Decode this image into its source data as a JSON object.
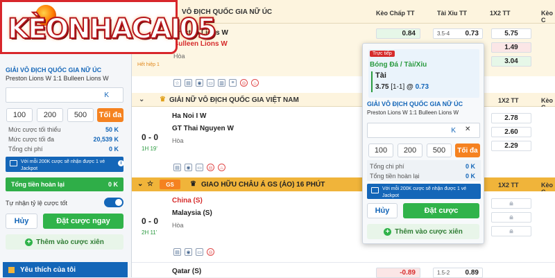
{
  "logo": {
    "text": "KÈONHACAI05"
  },
  "betslip": {
    "league": "GIẢI VÔ ĐỊCH QUỐC GIA NỮ ÚC",
    "match": "Preston Lions W 1:1 Bulleen Lions W",
    "input_suffix": "K",
    "amounts": [
      "100",
      "200",
      "500"
    ],
    "max_label": "Tối đa",
    "stats": [
      {
        "label": "Mức cược tối thiểu",
        "value": "50 K"
      },
      {
        "label": "Mức cược tối đa",
        "value": "20,539 K"
      },
      {
        "label": "Tổng chi phí",
        "value": "0 K"
      }
    ],
    "promo": "Với mỗi 200K cược sẽ nhận được 1 vé Jackpot",
    "refund_label": "Tổng tiền hoàn lại",
    "refund_value": "0 K",
    "auto_accept_label": "Tự nhận tỷ lệ cược tốt",
    "cancel_label": "Hủy",
    "place_label": "Đặt cược ngay",
    "add_parlay_label": "Thêm vào cược xiên",
    "favorites_label": "Yêu thích của tôi"
  },
  "columns": {
    "handicap": "Kèo Chấp TT",
    "overunder": "Tài Xỉu TT",
    "x12": "1X2 TT",
    "extra": "Kèo C"
  },
  "leagues": [
    {
      "name": "VÔ ĐỊCH QUỐC GIA NỮ ÚC",
      "home": "Preston Lions W",
      "away": "Bulleen Lions W",
      "draw": "Hòa",
      "status": "Hết hiệp 1",
      "odds": {
        "hcp_home": "0.84",
        "ou_line": "3.5-4",
        "ou_over": "0.73",
        "x1": "5.75",
        "x2": "1.49",
        "xd": "3.04"
      }
    },
    {
      "name": "GIẢI NỮ VÔ ĐỊCH QUỐC GIA VIỆT NAM",
      "home": "Ha Noi I W",
      "away": "GT Thai Nguyen W",
      "draw": "Hòa",
      "score": "0 - 0",
      "time": "1H 19'",
      "odds": {
        "x1": "2.78",
        "x2": "2.60",
        "xd": "2.29"
      }
    },
    {
      "name": "GIAO HỮU CHÂU Á GS (ẢO) 16 PHÚT",
      "badge": "GS",
      "home": "China (S)",
      "away": "Malaysia (S)",
      "draw": "Hòa",
      "score": "0 - 0",
      "time": "2H 11'"
    },
    {
      "home": "Qatar (S)",
      "odds": {
        "hcp_home": "-0.89",
        "ou_line": "1.5-2",
        "ou_over": "0.89"
      }
    }
  ],
  "popup": {
    "live_tag": "Trực tiếp",
    "market": "Bóng Đá / Tài/Xỉu",
    "selection": "Tài",
    "line": "3.75",
    "score": "[1-1]",
    "at": "@",
    "odds": "0.73",
    "league": "GIẢI VÔ ĐỊCH QUỐC GIA NỮ ÚC",
    "match": "Preston Lions W 1:1 Bulleen Lions W",
    "input_suffix": "K",
    "amounts": [
      "100",
      "200",
      "500"
    ],
    "max_label": "Tối đa",
    "stats": [
      {
        "label": "Tổng chi phí",
        "value": "0 K"
      },
      {
        "label": "Tổng tiền hoàn lại",
        "value": "0 K"
      }
    ],
    "promo": "Với mỗi 200K cược sẽ nhận được 1 vé Jackpot",
    "cancel_label": "Hủy",
    "place_label": "Đặt cược",
    "add_parlay_label": "Thêm vào cược xiên"
  }
}
